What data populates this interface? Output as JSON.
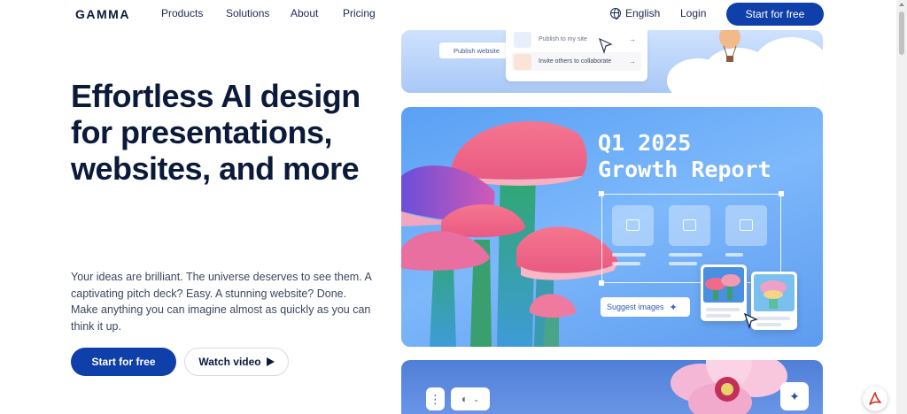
{
  "nav": {
    "logo": "GAMMA",
    "links": [
      "Products",
      "Solutions",
      "About",
      "Pricing"
    ],
    "language": "English",
    "login": "Login",
    "cta": "Start for free"
  },
  "hero": {
    "title": "Effortless AI design for presentations, websites, and more",
    "subtitle": "Your ideas are brilliant. The universe deserves to see them. A captivating pitch deck? Easy. A stunning website? Done. Make anything you can imagine almost as quickly as you can think it up.",
    "primary_button": "Start for free",
    "secondary_button": "Watch video"
  },
  "showcase": {
    "publish_button": "Publish website",
    "share_options": [
      "Publish to my site",
      "Invite others to collaborate"
    ],
    "report_title_line1": "Q1 2025",
    "report_title_line2": "Growth Report",
    "suggest_button": "Suggest images",
    "ai_badge": "AI"
  },
  "colors": {
    "brand": "#0f3fa8",
    "text": "#0b1a3a",
    "card_blue": "#5aa0f5",
    "mushroom_pink": "#f06a8c"
  }
}
